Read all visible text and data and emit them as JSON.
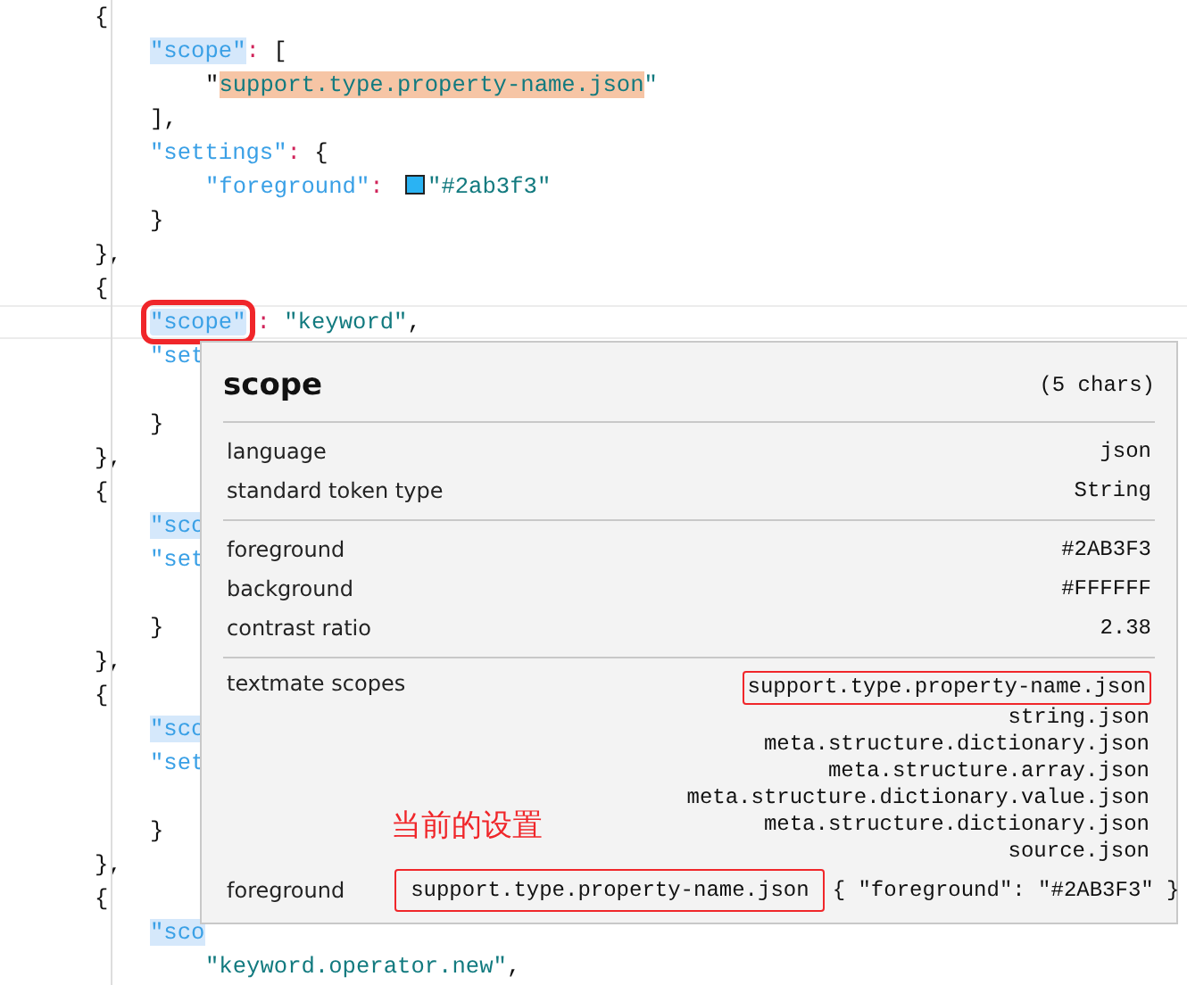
{
  "editor": {
    "lines": [
      {
        "tokens": [
          {
            "kind": "punct",
            "text": "{"
          }
        ],
        "children": [
          {
            "tokens": [
              {
                "kind": "key",
                "text": "\"scope\"",
                "selected": true
              },
              {
                "kind": "colon",
                "text": ": "
              },
              {
                "kind": "punct",
                "text": "["
              }
            ],
            "children": [
              {
                "tokens": [
                  {
                    "kind": "punct",
                    "text": "\""
                  },
                  {
                    "kind": "string",
                    "text": "support.type.property-name.json",
                    "matched": true
                  },
                  {
                    "kind": "string",
                    "text": "\""
                  }
                ]
              }
            ]
          },
          {
            "tokens": [
              {
                "kind": "punct",
                "text": "],"
              }
            ]
          },
          {
            "tokens": [
              {
                "kind": "key",
                "text": "\"settings\""
              },
              {
                "kind": "colon",
                "text": ": "
              },
              {
                "kind": "punct",
                "text": "{"
              }
            ],
            "children": [
              {
                "tokens": [
                  {
                    "kind": "key",
                    "text": "\"foreground\""
                  },
                  {
                    "kind": "colon",
                    "text": ": "
                  },
                  {
                    "kind": "swatch",
                    "color": "#2ab3f3"
                  },
                  {
                    "kind": "string",
                    "text": "\"#2ab3f3\""
                  }
                ]
              }
            ]
          },
          {
            "tokens": [
              {
                "kind": "punct",
                "text": "}"
              }
            ]
          }
        ]
      },
      {
        "tokens": [
          {
            "kind": "punct",
            "text": "},"
          }
        ]
      },
      {
        "tokens": [
          {
            "kind": "punct",
            "text": "{"
          }
        ],
        "children": [
          {
            "current": true,
            "tokens": [
              {
                "kind": "key",
                "text": "\"scope\"",
                "selected": true,
                "annotated": true
              },
              {
                "kind": "colon",
                "text": ": "
              },
              {
                "kind": "string",
                "text": "\"keyword\""
              },
              {
                "kind": "punct",
                "text": ","
              }
            ]
          },
          {
            "tokens": [
              {
                "kind": "key",
                "text": "\"set"
              }
            ],
            "children": [
              {
                "kind": "blank"
              }
            ]
          },
          {
            "tokens": [
              {
                "kind": "punct",
                "text": "}"
              }
            ]
          }
        ]
      },
      {
        "tokens": [
          {
            "kind": "punct",
            "text": "},"
          }
        ]
      },
      {
        "tokens": [
          {
            "kind": "punct",
            "text": "{"
          }
        ],
        "children": [
          {
            "tokens": [
              {
                "kind": "key",
                "text": "\"sco",
                "selected": true
              }
            ]
          },
          {
            "tokens": [
              {
                "kind": "key",
                "text": "\"set"
              }
            ],
            "children": [
              {
                "kind": "blank"
              }
            ]
          },
          {
            "tokens": [
              {
                "kind": "punct",
                "text": "}"
              }
            ]
          }
        ]
      },
      {
        "tokens": [
          {
            "kind": "punct",
            "text": "},"
          }
        ]
      },
      {
        "tokens": [
          {
            "kind": "punct",
            "text": "{"
          }
        ],
        "children": [
          {
            "tokens": [
              {
                "kind": "key",
                "text": "\"sco",
                "selected": true
              }
            ]
          },
          {
            "tokens": [
              {
                "kind": "key",
                "text": "\"set"
              }
            ],
            "children": [
              {
                "kind": "blank"
              }
            ]
          },
          {
            "tokens": [
              {
                "kind": "punct",
                "text": "}"
              }
            ]
          }
        ]
      },
      {
        "tokens": [
          {
            "kind": "punct",
            "text": "},"
          }
        ]
      },
      {
        "tokens": [
          {
            "kind": "punct",
            "text": "{"
          }
        ],
        "children": [
          {
            "tokens": [
              {
                "kind": "key",
                "text": "\"sco",
                "selected": true
              }
            ],
            "children": [
              {
                "tokens": [
                  {
                    "kind": "string",
                    "text": "\"keyword.operator.new\""
                  },
                  {
                    "kind": "punct",
                    "text": ","
                  }
                ]
              }
            ]
          }
        ]
      }
    ]
  },
  "hover": {
    "title": "scope",
    "length": "(5 chars)",
    "sections": [
      [
        {
          "label": "language",
          "value": "json"
        },
        {
          "label": "standard token type",
          "value": "String"
        }
      ],
      [
        {
          "label": "foreground",
          "value": "#2AB3F3"
        },
        {
          "label": "background",
          "value": "#FFFFFF"
        },
        {
          "label": "contrast ratio",
          "value": "2.38"
        }
      ]
    ],
    "textmate": {
      "label": "textmate scopes",
      "scopes": [
        {
          "text": "support.type.property-name.json",
          "annotated": true
        },
        {
          "text": "string.json",
          "annotated": false
        },
        {
          "text": "meta.structure.dictionary.json",
          "annotated": false
        },
        {
          "text": "meta.structure.array.json",
          "annotated": false
        },
        {
          "text": "meta.structure.dictionary.value.json",
          "annotated": false
        },
        {
          "text": "meta.structure.dictionary.json",
          "annotated": false
        },
        {
          "text": "source.json",
          "annotated": false
        }
      ]
    },
    "annotation": "当前的设置",
    "rule": {
      "label": "foreground",
      "selector": "support.type.property-name.json",
      "value": "{ \"foreground\": \"#2AB3F3\" }",
      "annotated": true
    }
  }
}
